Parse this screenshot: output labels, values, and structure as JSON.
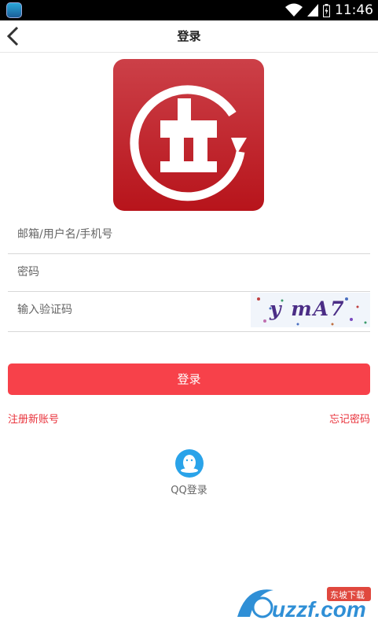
{
  "status_bar": {
    "time": "11:46"
  },
  "header": {
    "title": "登录"
  },
  "form": {
    "account_placeholder": "邮箱/用户名/手机号",
    "password_placeholder": "密码",
    "captcha_placeholder": "输入验证码",
    "captcha_text": "y mA7"
  },
  "actions": {
    "login_label": "登录",
    "register_label": "注册新账号",
    "forgot_label": "忘记密码"
  },
  "social": {
    "qq_label": "QQ登录"
  },
  "watermark": {
    "text": "uzzf.com",
    "badge": "东坡下载"
  },
  "colors": {
    "accent": "#f7414a",
    "link": "#e9323b",
    "qq": "#2aa3e9"
  }
}
